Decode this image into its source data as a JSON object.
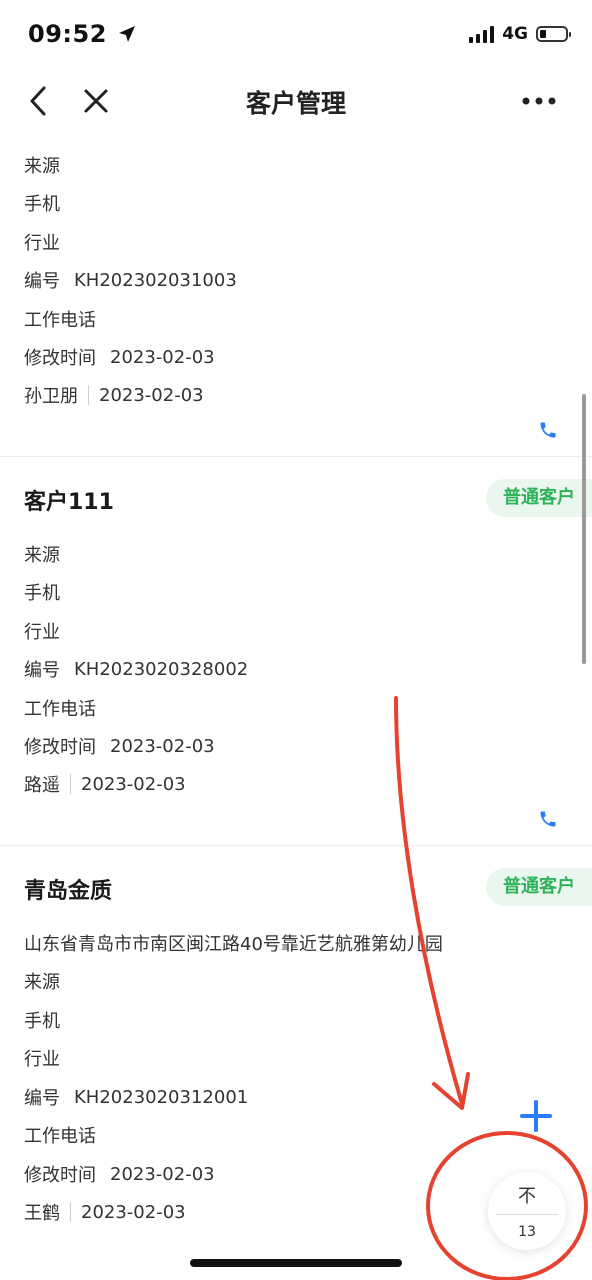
{
  "status_bar": {
    "time": "09:52",
    "network": "4G"
  },
  "nav": {
    "title": "客户管理"
  },
  "cards": [
    {
      "fields": [
        "来源",
        "手机",
        "行业"
      ],
      "code_label": "编号",
      "code_value": "KH202302031003",
      "work_phone": "工作电话",
      "modified_label": "修改时间",
      "modified_value": "2023-02-03",
      "owner": "孙卫朋",
      "owner_date": "2023-02-03"
    },
    {
      "title": "客户111",
      "badge": "普通客户",
      "fields": [
        "来源",
        "手机",
        "行业"
      ],
      "code_label": "编号",
      "code_value": "KH2023020328002",
      "work_phone": "工作电话",
      "modified_label": "修改时间",
      "modified_value": "2023-02-03",
      "owner": "路遥",
      "owner_date": "2023-02-03"
    },
    {
      "title": "青岛金质",
      "badge": "普通客户",
      "address": "山东省青岛市市南区闽江路40号靠近艺航雅第幼儿园",
      "fields": [
        "来源",
        "手机",
        "行业"
      ],
      "code_label": "编号",
      "code_value": "KH2023020312001",
      "work_phone": "工作电话",
      "modified_label": "修改时间",
      "modified_value": "2023-02-03",
      "owner": "王鹤",
      "owner_date": "2023-02-03"
    }
  ],
  "float_widget": {
    "top_label": "不",
    "count": "13"
  },
  "colors": {
    "accent_blue": "#2b7cf6",
    "badge_green": "#2fb35a",
    "annotation_red": "#e5432f"
  },
  "icons": [
    "back-arrow-icon",
    "close-icon",
    "more-icon",
    "phone-icon",
    "plus-icon",
    "location-arrow-icon"
  ]
}
